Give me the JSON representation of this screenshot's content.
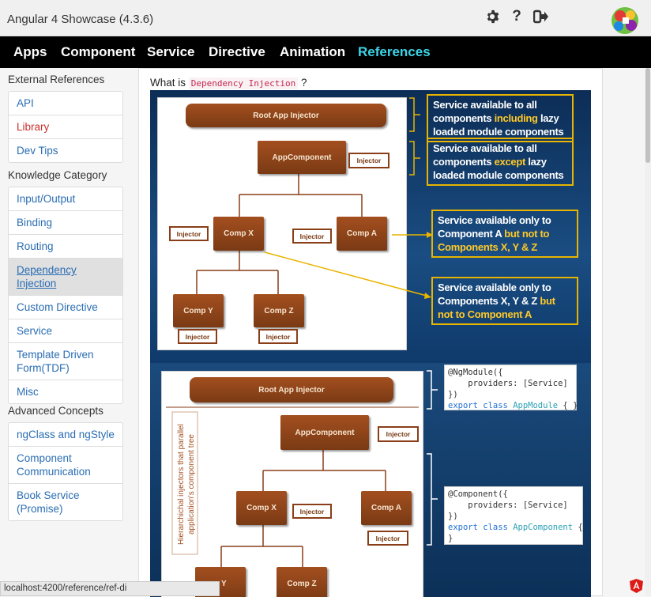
{
  "app": {
    "title": "Angular 4 Showcase (4.3.6)",
    "icons": [
      "gear-icon",
      "help-icon",
      "logout-icon"
    ]
  },
  "nav": {
    "items": [
      "Apps",
      "Component",
      "Service",
      "Directive",
      "Animation",
      "References"
    ],
    "active": "References",
    "active_color": "#3cd3e6"
  },
  "sidebar": {
    "sections": [
      {
        "heading": "External References",
        "items": [
          "API",
          "Library",
          "Dev Tips"
        ]
      },
      {
        "heading": "Knowledge Category",
        "items": [
          "Input/Output",
          "Binding",
          "Routing",
          "Dependency Injection",
          "Custom Directive",
          "Service",
          "Template Driven Form(TDF)",
          "Misc"
        ]
      },
      {
        "heading": "Advanced Concepts",
        "items": [
          "ngClass and ngStyle",
          "Component Communication",
          "Book Service (Promise)"
        ]
      }
    ],
    "selected": "Dependency Injection"
  },
  "content": {
    "question_prefix": "What is",
    "question_code": "Dependency Injection",
    "question_suffix": "?"
  },
  "diagram1": {
    "root": "Root App Injector",
    "app": "AppComponent",
    "injector": "Injector",
    "comp_x": "Comp X",
    "comp_a": "Comp A",
    "comp_y": "Comp Y",
    "comp_z": "Comp Z",
    "note1_a": "Service available to all components",
    "note1_hl": "including",
    "note1_b": "lazy loaded module components",
    "note2_a": "Service available to all components",
    "note2_hl": "except",
    "note2_b": "lazy loaded module components",
    "note3_a": "Service available only to Component A",
    "note3_hl": "but not to Components X, Y & Z",
    "note4_a": "Service available only to Components X, Y & Z",
    "note4_hl": "but not to Component A"
  },
  "diagram2": {
    "root": "Root App Injector",
    "app": "AppComponent",
    "injector": "Injector",
    "comp_x": "Comp X",
    "comp_a": "Comp A",
    "comp_y": "p Y",
    "comp_z": "Comp Z",
    "vertical_label": "Hierarchichal injectors that parallel application's component tree",
    "code1_line1": "@NgModule({",
    "code1_line2": "    providers: [Service]",
    "code1_line3": "})",
    "code1_kw": "export class",
    "code1_cls": "AppModule",
    "code1_end": "{ }",
    "code2_line1": "@Component({",
    "code2_line2": "    providers: [Service]",
    "code2_line3": "})",
    "code2_kw": "export class",
    "code2_cls": "AppComponent",
    "code2_end": "{",
    "code2_line5": "}"
  },
  "statusbar": {
    "url": "localhost:4200/reference/ref-di"
  }
}
